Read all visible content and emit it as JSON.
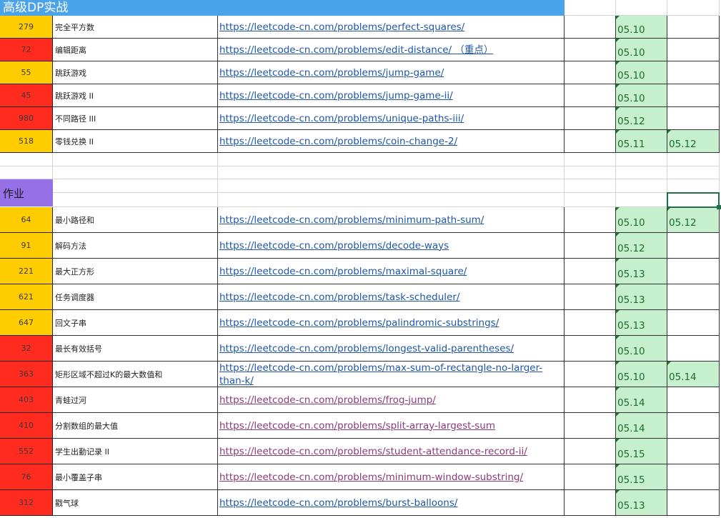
{
  "section1_title": "高级DP实战",
  "section2_title": "作业",
  "section1": [
    {
      "id": "279",
      "name": "完全平方数",
      "url": "https://leetcode-cn.com/problems/perfect-squares/",
      "color": "#ffcc00",
      "visited": false,
      "d1": "05.10",
      "d2": ""
    },
    {
      "id": "72",
      "name": "编辑距离",
      "url": "https://leetcode-cn.com/problems/edit-distance/ （重点）",
      "color": "#ff2b1f",
      "visited": false,
      "d1": "05.10",
      "d2": ""
    },
    {
      "id": "55",
      "name": "跳跃游戏",
      "url": "https://leetcode-cn.com/problems/jump-game/",
      "color": "#ffcc00",
      "visited": false,
      "d1": "05.10",
      "d2": ""
    },
    {
      "id": "45",
      "name": "跳跃游戏 II",
      "url": "https://leetcode-cn.com/problems/jump-game-ii/",
      "color": "#ff2b1f",
      "visited": false,
      "d1": "05.10",
      "d2": ""
    },
    {
      "id": "980",
      "name": "不同路径 III",
      "url": "https://leetcode-cn.com/problems/unique-paths-iii/",
      "color": "#ff2b1f",
      "visited": false,
      "d1": "05.12",
      "d2": ""
    },
    {
      "id": "518",
      "name": "零钱兑换 II",
      "url": "https://leetcode-cn.com/problems/coin-change-2/",
      "color": "#ffcc00",
      "visited": false,
      "d1": "05.11",
      "d2": "05.12"
    }
  ],
  "section2": [
    {
      "id": "64",
      "name": "最小路径和",
      "url": "https://leetcode-cn.com/problems/minimum-path-sum/",
      "color": "#ffcc00",
      "visited": false,
      "d1": "05.10",
      "d2": "05.12"
    },
    {
      "id": "91",
      "name": "解码方法",
      "url": "https://leetcode-cn.com/problems/decode-ways",
      "color": "#ffcc00",
      "visited": false,
      "d1": "05.12",
      "d2": ""
    },
    {
      "id": "221",
      "name": "最大正方形",
      "url": "https://leetcode-cn.com/problems/maximal-square/",
      "color": "#ffcc00",
      "visited": false,
      "d1": "05.13",
      "d2": ""
    },
    {
      "id": "621",
      "name": "任务调度器",
      "url": "https://leetcode-cn.com/problems/task-scheduler/",
      "color": "#ffcc00",
      "visited": false,
      "d1": "05.13",
      "d2": ""
    },
    {
      "id": "647",
      "name": "回文子串",
      "url": "https://leetcode-cn.com/problems/palindromic-substrings/",
      "color": "#ffcc00",
      "visited": false,
      "d1": "05.13",
      "d2": ""
    },
    {
      "id": "32",
      "name": "最长有效括号",
      "url": "https://leetcode-cn.com/problems/longest-valid-parentheses/",
      "color": "#ff2b1f",
      "visited": false,
      "d1": "05.10",
      "d2": ""
    },
    {
      "id": "363",
      "name": "矩形区域不超过K的最大数值和",
      "url": "https://leetcode-cn.com/problems/max-sum-of-rectangle-no-larger-than-k/",
      "color": "#ff2b1f",
      "visited": false,
      "d1": "05.10",
      "d2": "05.14"
    },
    {
      "id": "403",
      "name": "青蛙过河",
      "url": "https://leetcode-cn.com/problems/frog-jump/",
      "color": "#ff2b1f",
      "visited": true,
      "d1": "05.14",
      "d2": ""
    },
    {
      "id": "410",
      "name": "分割数组的最大值",
      "url": "https://leetcode-cn.com/problems/split-array-largest-sum",
      "color": "#ff2b1f",
      "visited": true,
      "d1": "05.14",
      "d2": ""
    },
    {
      "id": "552",
      "name": "学生出勤记录 II",
      "url": "https://leetcode-cn.com/problems/student-attendance-record-ii/",
      "color": "#ff2b1f",
      "visited": true,
      "d1": "05.15",
      "d2": ""
    },
    {
      "id": "76",
      "name": "最小覆盖子串",
      "url": "https://leetcode-cn.com/problems/minimum-window-substring/",
      "color": "#ff2b1f",
      "visited": true,
      "d1": "05.15",
      "d2": ""
    },
    {
      "id": "312",
      "name": "戳气球",
      "url": "https://leetcode-cn.com/problems/burst-balloons/",
      "color": "#ff2b1f",
      "visited": false,
      "d1": "05.13",
      "d2": ""
    }
  ]
}
